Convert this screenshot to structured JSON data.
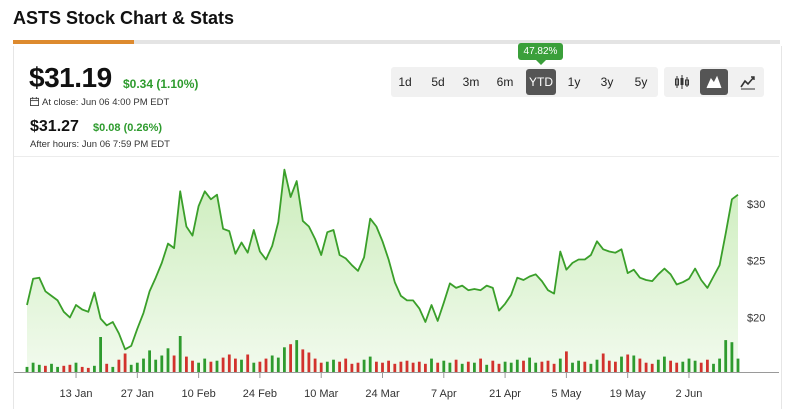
{
  "header": {
    "title": "ASTS Stock Chart & Stats"
  },
  "quote": {
    "price": "$31.19",
    "change": "$0.34 (1.10%)",
    "close_label": "At close: Jun 06 4:00 PM EDT",
    "after_price": "$31.27",
    "after_change": "$0.08 (0.26%)",
    "after_label": "After hours: Jun 06 7:59 PM EDT"
  },
  "ranges": [
    "1d",
    "5d",
    "3m",
    "6m",
    "YTD",
    "1y",
    "3y",
    "5y"
  ],
  "active_range": "YTD",
  "ytd_badge": "47.82%",
  "chart_types": [
    {
      "name": "candlestick",
      "icon": "candlestick-icon"
    },
    {
      "name": "mountain",
      "icon": "mountain-chart-icon",
      "active": true
    },
    {
      "name": "line",
      "icon": "line-chart-icon"
    }
  ],
  "colors": {
    "line": "#3a9f2a",
    "area": "#c9ecb8",
    "up_volume": "#2e9b2e",
    "down_volume": "#d2322d",
    "accent": "#dd8a2e"
  },
  "chart_data": {
    "type": "area",
    "x_ticks": [
      "13 Jan",
      "27 Jan",
      "10 Feb",
      "24 Feb",
      "10 Mar",
      "24 Mar",
      "7 Apr",
      "21 Apr",
      "5 May",
      "19 May",
      "2 Jun"
    ],
    "y_ticks": [
      "$30",
      "$25",
      "$20"
    ],
    "ylim": [
      15.2,
      32.8
    ],
    "price": [
      21.1,
      23.4,
      23.5,
      22.3,
      21.9,
      21.5,
      20.5,
      20.0,
      21.1,
      20.7,
      20.5,
      22.2,
      19.9,
      19.3,
      19.6,
      18.6,
      17.2,
      17.5,
      19.0,
      20.4,
      22.3,
      23.5,
      24.8,
      26.5,
      26.1,
      31.1,
      28.0,
      27.2,
      29.8,
      31.1,
      30.4,
      30.8,
      27.8,
      27.6,
      25.6,
      26.6,
      25.7,
      27.7,
      25.8,
      25.1,
      26.3,
      28.4,
      33.0,
      30.6,
      32.0,
      28.5,
      28.0,
      26.9,
      25.5,
      27.5,
      27.7,
      25.5,
      25.2,
      24.6,
      24.1,
      25.3,
      28.7,
      28.0,
      26.7,
      25.1,
      23.1,
      21.9,
      21.5,
      21.5,
      20.8,
      19.6,
      21.1,
      19.7,
      21.3,
      23.0,
      22.6,
      22.8,
      22.4,
      22.5,
      22.4,
      22.8,
      22.6,
      20.6,
      21.2,
      22.0,
      23.5,
      23.3,
      23.6,
      23.8,
      23.2,
      22.4,
      22.1,
      25.8,
      24.2,
      24.8,
      25.1,
      25.1,
      25.5,
      26.7,
      26.0,
      25.8,
      25.7,
      26.0,
      23.9,
      24.2,
      23.5,
      23.3,
      23.2,
      23.8,
      24.3,
      23.8,
      22.9,
      23.1,
      23.4,
      24.3,
      23.3,
      22.6,
      23.6,
      24.6,
      27.4,
      30.4,
      30.8
    ],
    "volume": [
      5,
      9,
      7,
      6,
      8,
      5,
      6,
      7,
      9,
      5,
      4,
      6,
      34,
      8,
      5,
      12,
      18,
      7,
      9,
      13,
      21,
      12,
      16,
      23,
      16,
      35,
      15,
      11,
      9,
      13,
      10,
      11,
      14,
      17,
      13,
      12,
      17,
      9,
      10,
      13,
      16,
      14,
      24,
      27,
      31,
      22,
      19,
      13,
      9,
      10,
      12,
      10,
      13,
      8,
      9,
      12,
      15,
      10,
      9,
      11,
      8,
      10,
      11,
      9,
      10,
      8,
      13,
      9,
      11,
      9,
      12,
      8,
      10,
      9,
      13,
      7,
      11,
      8,
      10,
      9,
      12,
      11,
      14,
      9,
      10,
      11,
      8,
      13,
      20,
      9,
      11,
      10,
      8,
      12,
      18,
      11,
      10,
      15,
      17,
      16,
      13,
      9,
      8,
      12,
      15,
      11,
      9,
      10,
      13,
      11,
      9,
      12,
      8,
      13,
      31,
      29,
      13
    ],
    "volume_up": [
      true,
      true,
      true,
      false,
      true,
      true,
      false,
      false,
      true,
      false,
      false,
      true,
      true,
      false,
      true,
      false,
      false,
      true,
      true,
      true,
      true,
      true,
      true,
      true,
      false,
      true,
      false,
      false,
      true,
      true,
      false,
      true,
      false,
      false,
      false,
      true,
      false,
      true,
      false,
      false,
      true,
      true,
      true,
      false,
      true,
      false,
      false,
      false,
      false,
      true,
      true,
      false,
      false,
      false,
      false,
      true,
      true,
      false,
      false,
      false,
      false,
      false,
      false,
      false,
      false,
      false,
      true,
      false,
      true,
      true,
      false,
      true,
      false,
      true,
      false,
      true,
      false,
      false,
      true,
      true,
      true,
      false,
      true,
      true,
      false,
      false,
      false,
      true,
      false,
      true,
      true,
      false,
      true,
      true,
      false,
      false,
      false,
      true,
      false,
      true,
      false,
      false,
      false,
      true,
      true,
      false,
      false,
      true,
      true,
      true,
      false,
      false,
      true,
      true,
      true,
      true,
      true
    ]
  }
}
